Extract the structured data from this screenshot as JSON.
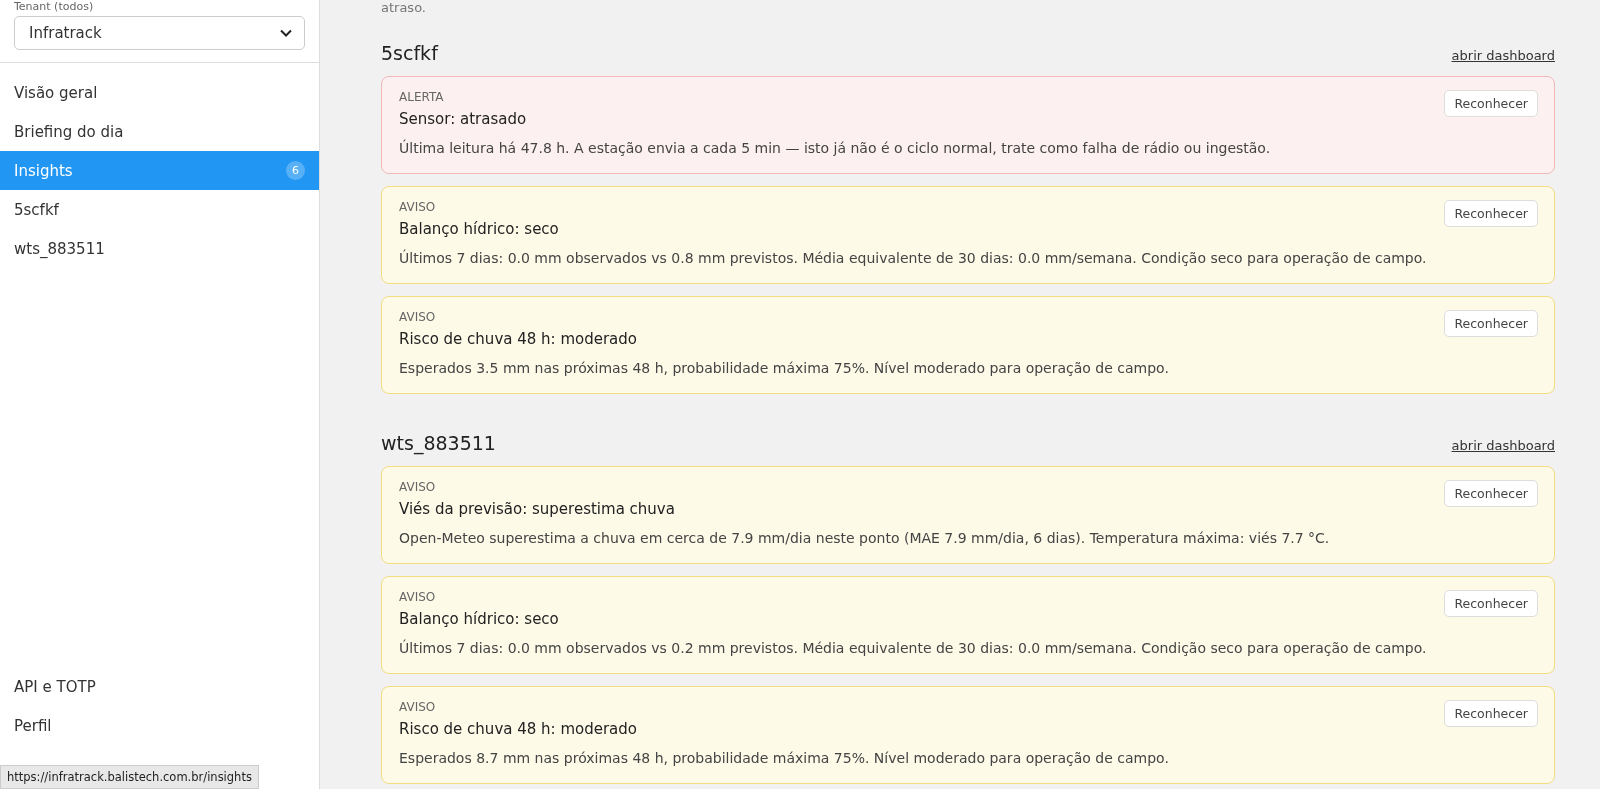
{
  "sidebar": {
    "tenant_label": "Tenant (todos)",
    "tenant_select": {
      "value": "Infratrack"
    },
    "items": [
      {
        "label": "Visão geral",
        "selected": false
      },
      {
        "label": "Briefing do dia",
        "selected": false
      },
      {
        "label": "Insights",
        "selected": true,
        "badge": "6"
      },
      {
        "label": "5scfkf",
        "selected": false
      },
      {
        "label": "wts_883511",
        "selected": false
      }
    ],
    "bottom_items": [
      {
        "label": "API e TOTP",
        "selected": false
      },
      {
        "label": "Perfil",
        "selected": false
      }
    ]
  },
  "main": {
    "intro_tail": "atraso.",
    "stations": [
      {
        "name": "5scfkf",
        "link": "abrir dashboard",
        "insights": [
          {
            "kind": "alert",
            "level_label": "ALERTA",
            "title": "Sensor: atrasado",
            "text": "Última leitura há 47.8 h. A estação envia a cada 5 min — isto já não é o ciclo normal, trate como falha de rádio ou ingestão.",
            "button": "Reconhecer"
          },
          {
            "kind": "warning",
            "level_label": "AVISO",
            "title": "Balanço hídrico: seco",
            "text": "Últimos 7 dias: 0.0 mm observados vs 0.8 mm previstos. Média equivalente de 30 dias: 0.0 mm/semana. Condição seco para operação de campo.",
            "button": "Reconhecer"
          },
          {
            "kind": "warning",
            "level_label": "AVISO",
            "title": "Risco de chuva 48 h: moderado",
            "text": "Esperados 3.5 mm nas próximas 48 h, probabilidade máxima 75%. Nível moderado para operação de campo.",
            "button": "Reconhecer"
          }
        ]
      },
      {
        "name": "wts_883511",
        "link": "abrir dashboard",
        "insights": [
          {
            "kind": "warning",
            "level_label": "AVISO",
            "title": "Viés da previsão: superestima chuva",
            "text": "Open-Meteo superestima a chuva em cerca de 7.9 mm/dia neste ponto (MAE 7.9 mm/dia, 6 dias). Temperatura máxima: viés 7.7 °C.",
            "button": "Reconhecer"
          },
          {
            "kind": "warning",
            "level_label": "AVISO",
            "title": "Balanço hídrico: seco",
            "text": "Últimos 7 dias: 0.0 mm observados vs 0.2 mm previstos. Média equivalente de 30 dias: 0.0 mm/semana. Condição seco para operação de campo.",
            "button": "Reconhecer"
          },
          {
            "kind": "warning",
            "level_label": "AVISO",
            "title": "Risco de chuva 48 h: moderado",
            "text": "Esperados 8.7 mm nas próximas 48 h, probabilidade máxima 75%. Nível moderado para operação de campo.",
            "button": "Reconhecer"
          }
        ]
      }
    ]
  },
  "status_url": "https://infratrack.balistech.com.br/insights"
}
